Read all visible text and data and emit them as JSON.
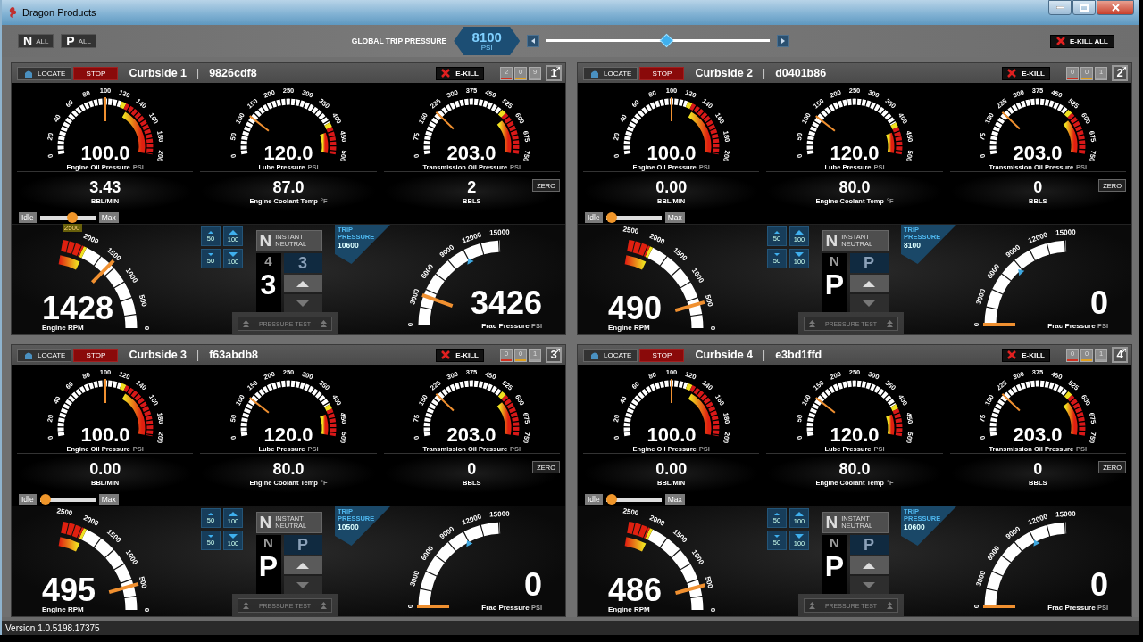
{
  "window": {
    "title": "Dragon Products"
  },
  "toolbar": {
    "neutral_all": {
      "letter": "N",
      "label": "ALL"
    },
    "park_all": {
      "letter": "P",
      "label": "ALL"
    },
    "global_trip": {
      "label": "GLOBAL TRIP PRESSURE",
      "value": "8100",
      "unit": "PSI",
      "level": 0.54
    },
    "ekill_all": "E-KILL ALL"
  },
  "panels": [
    {
      "name": "Curbside 1",
      "separator": "|",
      "serial": "9826cdf8",
      "number": "1",
      "locate": "LOCATE",
      "stop": "STOP",
      "ekill": "E-KILL",
      "counts": [
        {
          "value": "2",
          "color": "#d03020"
        },
        {
          "value": "0",
          "color": "#e0a020"
        },
        {
          "value": "9",
          "color": "#a0a0a0"
        }
      ],
      "gauges": [
        {
          "value": "100.0",
          "label": "Engine Oil Pressure",
          "unit": "PSI",
          "ticks": [
            "0",
            "20",
            "40",
            "60",
            "80",
            "100",
            "120",
            "140",
            "160",
            "180",
            "200"
          ]
        },
        {
          "value": "120.0",
          "label": "Lube Pressure",
          "unit": "PSI",
          "ticks": [
            "0",
            "50",
            "100",
            "150",
            "200",
            "250",
            "300",
            "350",
            "400",
            "450",
            "500"
          ]
        },
        {
          "value": "203.0",
          "label": "Transmission Oil Pressure",
          "unit": "PSI",
          "ticks": [
            "0",
            "75",
            "150",
            "225",
            "300",
            "375",
            "450",
            "525",
            "600",
            "675",
            "750"
          ]
        }
      ],
      "readouts": [
        {
          "value": "3.43",
          "label": "BBL/MIN"
        },
        {
          "value": "87.0",
          "label": "Engine Coolant Temp",
          "unit": "°F"
        },
        {
          "value": "2",
          "label": "BBLS"
        }
      ],
      "zero": "ZERO",
      "throttle": {
        "min": "Idle",
        "max": "Max",
        "level": 0.6,
        "tooltip": "2500"
      },
      "rpm": {
        "value": "1428",
        "label": "Engine RPM",
        "ticks": [
          "2000",
          "1500",
          "1000",
          "500",
          "0"
        ]
      },
      "steps": [
        "50",
        "100",
        "50",
        "100"
      ],
      "gear": {
        "instant": "N",
        "instant_label": "INSTANT NEUTRAL",
        "previous": "4",
        "current": "3",
        "target": "3"
      },
      "pressure_test": "PRESSURE TEST",
      "trip": {
        "label": "TRIP PRESSURE",
        "value": "10600"
      },
      "frac": {
        "value": "3426",
        "label": "Frac Pressure",
        "unit": "PSI",
        "ticks": [
          "0",
          "3000",
          "6000",
          "9000",
          "12000",
          "15000"
        ]
      }
    },
    {
      "name": "Curbside 2",
      "separator": "|",
      "serial": "d0401b86",
      "number": "2",
      "locate": "LOCATE",
      "stop": "STOP",
      "ekill": "E-KILL",
      "counts": [
        {
          "value": "0",
          "color": "#d03020"
        },
        {
          "value": "0",
          "color": "#e0a020"
        },
        {
          "value": "1",
          "color": "#a0a0a0"
        }
      ],
      "gauges": [
        {
          "value": "100.0",
          "label": "Engine Oil Pressure",
          "unit": "PSI",
          "ticks": [
            "0",
            "20",
            "40",
            "60",
            "80",
            "100",
            "120",
            "140",
            "160",
            "180",
            "200"
          ]
        },
        {
          "value": "120.0",
          "label": "Lube Pressure",
          "unit": "PSI",
          "ticks": [
            "0",
            "50",
            "100",
            "150",
            "200",
            "250",
            "300",
            "350",
            "400",
            "450",
            "500"
          ]
        },
        {
          "value": "203.0",
          "label": "Transmission Oil Pressure",
          "unit": "PSI",
          "ticks": [
            "0",
            "75",
            "150",
            "225",
            "300",
            "375",
            "450",
            "525",
            "600",
            "675",
            "750"
          ]
        }
      ],
      "readouts": [
        {
          "value": "0.00",
          "label": "BBL/MIN"
        },
        {
          "value": "80.0",
          "label": "Engine Coolant Temp",
          "unit": "°F"
        },
        {
          "value": "0",
          "label": "BBLS"
        }
      ],
      "zero": "ZERO",
      "throttle": {
        "min": "Idle",
        "max": "Max",
        "level": 0
      },
      "rpm": {
        "value": "490",
        "label": "Engine RPM",
        "ticks": [
          "2500",
          "2000",
          "1500",
          "1000",
          "500",
          "0"
        ]
      },
      "steps": [
        "50",
        "100",
        "50",
        "100"
      ],
      "gear": {
        "instant": "N",
        "instant_label": "INSTANT NEUTRAL",
        "previous": "N",
        "current": "P",
        "target": "P"
      },
      "pressure_test": "PRESSURE TEST",
      "trip": {
        "label": "TRIP PRESSURE",
        "value": "8100"
      },
      "frac": {
        "value": "0",
        "label": "Frac Pressure",
        "unit": "PSI",
        "ticks": [
          "0",
          "3000",
          "6000",
          "9000",
          "12000",
          "15000"
        ]
      }
    },
    {
      "name": "Curbside 3",
      "separator": "|",
      "serial": "f63abdb8",
      "number": "3",
      "locate": "LOCATE",
      "stop": "STOP",
      "ekill": "E-KILL",
      "counts": [
        {
          "value": "0",
          "color": "#d03020"
        },
        {
          "value": "0",
          "color": "#e0a020"
        },
        {
          "value": "1",
          "color": "#a0a0a0"
        }
      ],
      "gauges": [
        {
          "value": "100.0",
          "label": "Engine Oil Pressure",
          "unit": "PSI",
          "ticks": [
            "0",
            "20",
            "40",
            "60",
            "80",
            "100",
            "120",
            "140",
            "160",
            "180",
            "200"
          ]
        },
        {
          "value": "120.0",
          "label": "Lube Pressure",
          "unit": "PSI",
          "ticks": [
            "0",
            "50",
            "100",
            "150",
            "200",
            "250",
            "300",
            "350",
            "400",
            "450",
            "500"
          ]
        },
        {
          "value": "203.0",
          "label": "Transmission Oil Pressure",
          "unit": "PSI",
          "ticks": [
            "0",
            "75",
            "150",
            "225",
            "300",
            "375",
            "450",
            "525",
            "600",
            "675",
            "750"
          ]
        }
      ],
      "readouts": [
        {
          "value": "0.00",
          "label": "BBL/MIN"
        },
        {
          "value": "80.0",
          "label": "Engine Coolant Temp",
          "unit": "°F"
        },
        {
          "value": "0",
          "label": "BBLS"
        }
      ],
      "zero": "ZERO",
      "throttle": {
        "min": "Idle",
        "max": "Max",
        "level": 0
      },
      "rpm": {
        "value": "495",
        "label": "Engine RPM",
        "ticks": [
          "2500",
          "2000",
          "1500",
          "1000",
          "500",
          "0"
        ]
      },
      "steps": [
        "50",
        "100",
        "50",
        "100"
      ],
      "gear": {
        "instant": "N",
        "instant_label": "INSTANT NEUTRAL",
        "previous": "N",
        "current": "P",
        "target": "P"
      },
      "pressure_test": "PRESSURE TEST",
      "trip": {
        "label": "TRIP PRESSURE",
        "value": "10500"
      },
      "frac": {
        "value": "0",
        "label": "Frac Pressure",
        "unit": "PSI",
        "ticks": [
          "0",
          "3000",
          "6000",
          "9000",
          "12000",
          "15000"
        ]
      }
    },
    {
      "name": "Curbside 4",
      "separator": "|",
      "serial": "e3bd1ffd",
      "number": "4",
      "locate": "LOCATE",
      "stop": "STOP",
      "ekill": "E-KILL",
      "counts": [
        {
          "value": "0",
          "color": "#d03020"
        },
        {
          "value": "0",
          "color": "#e0a020"
        },
        {
          "value": "1",
          "color": "#a0a0a0"
        }
      ],
      "gauges": [
        {
          "value": "100.0",
          "label": "Engine Oil Pressure",
          "unit": "PSI",
          "ticks": [
            "0",
            "20",
            "40",
            "60",
            "80",
            "100",
            "120",
            "140",
            "160",
            "180",
            "200"
          ]
        },
        {
          "value": "120.0",
          "label": "Lube Pressure",
          "unit": "PSI",
          "ticks": [
            "0",
            "50",
            "100",
            "150",
            "200",
            "250",
            "300",
            "350",
            "400",
            "450",
            "500"
          ]
        },
        {
          "value": "203.0",
          "label": "Transmission Oil Pressure",
          "unit": "PSI",
          "ticks": [
            "0",
            "75",
            "150",
            "225",
            "300",
            "375",
            "450",
            "525",
            "600",
            "675",
            "750"
          ]
        }
      ],
      "readouts": [
        {
          "value": "0.00",
          "label": "BBL/MIN"
        },
        {
          "value": "80.0",
          "label": "Engine Coolant Temp",
          "unit": "°F"
        },
        {
          "value": "0",
          "label": "BBLS"
        }
      ],
      "zero": "ZERO",
      "throttle": {
        "min": "Idle",
        "max": "Max",
        "level": 0
      },
      "rpm": {
        "value": "486",
        "label": "Engine RPM",
        "ticks": [
          "2500",
          "2000",
          "1500",
          "1000",
          "500",
          "0"
        ]
      },
      "steps": [
        "50",
        "100",
        "50",
        "100"
      ],
      "gear": {
        "instant": "N",
        "instant_label": "INSTANT NEUTRAL",
        "previous": "N",
        "current": "P",
        "target": "P"
      },
      "pressure_test": "PRESSURE TEST",
      "trip": {
        "label": "TRIP PRESSURE",
        "value": "10600"
      },
      "frac": {
        "value": "0",
        "label": "Frac Pressure",
        "unit": "PSI",
        "ticks": [
          "0",
          "3000",
          "6000",
          "9000",
          "12000",
          "15000"
        ]
      }
    }
  ],
  "status_bar": {
    "version": "Version 1.0.5198.17375"
  }
}
